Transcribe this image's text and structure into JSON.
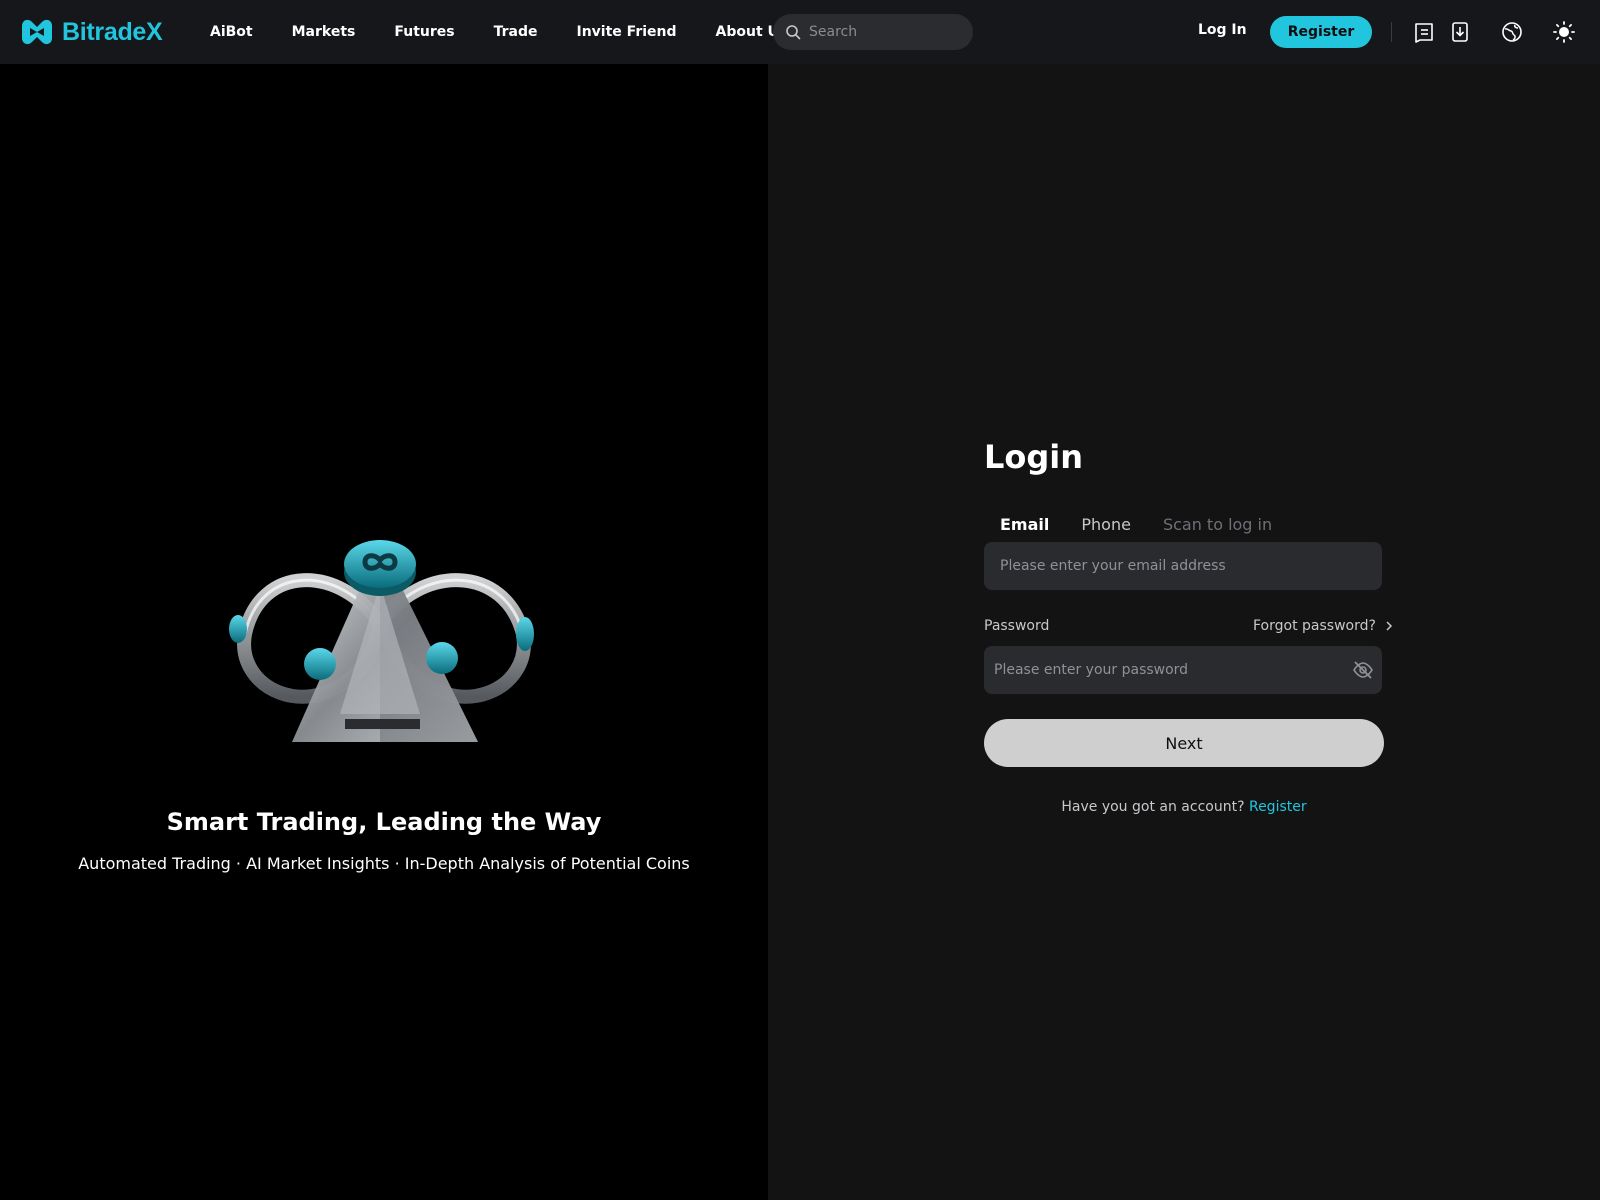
{
  "brand": {
    "name": "BitradeX",
    "accent_color": "#21c6de"
  },
  "nav": {
    "links": [
      "AiBot",
      "Markets",
      "Futures",
      "Trade",
      "Invite Friend",
      "About Us"
    ],
    "search_placeholder": "Search",
    "login_label": "Log In",
    "register_label": "Register",
    "icons": [
      "message-icon",
      "download-icon",
      "language-globe-icon",
      "theme-sun-icon"
    ]
  },
  "hero": {
    "title": "Smart Trading, Leading the Way",
    "subtitle": "Automated Trading · AI Market Insights · In-Depth Analysis of Potential Coins"
  },
  "login": {
    "title": "Login",
    "tabs": [
      {
        "label": "Email",
        "state": "active"
      },
      {
        "label": "Phone",
        "state": "normal"
      },
      {
        "label": "Scan to log in",
        "state": "muted"
      }
    ],
    "email_placeholder": "Please enter your email address",
    "email_value": "",
    "password_label": "Password",
    "forgot_label": "Forgot password?",
    "password_placeholder": "Please enter your password",
    "password_value": "",
    "next_label": "Next",
    "footer_prompt": "Have you got an account?",
    "footer_link": "Register"
  }
}
